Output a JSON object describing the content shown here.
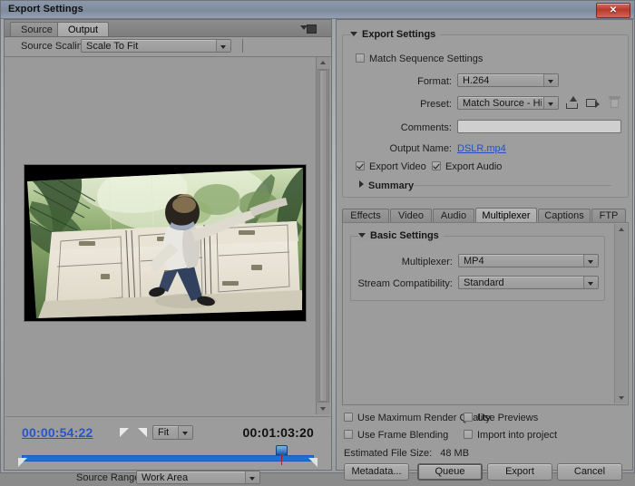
{
  "window": {
    "title": "Export Settings",
    "close_label": "✕"
  },
  "left_panel": {
    "tabs": [
      {
        "label": "Source",
        "active": false
      },
      {
        "label": "Output",
        "active": true
      }
    ],
    "panel_menu_icon": "panel-menu-icon",
    "source_scaling": {
      "label": "Source Scaling:",
      "value": "Scale To Fit"
    },
    "preview": {
      "alt": "video-preview-frame"
    },
    "transport": {
      "current_timecode": "00:00:54:22",
      "duration_timecode": "00:01:03:20",
      "mark_in_icon": "mark-in-icon",
      "mark_out_icon": "mark-out-icon",
      "zoom_level": "Fit",
      "playhead_percent": 88
    },
    "source_range": {
      "label": "Source Range:",
      "value": "Work Area"
    }
  },
  "right_panel": {
    "export_settings": {
      "title": "Export Settings",
      "expanded": true,
      "match_sequence_settings": {
        "label": "Match Sequence Settings",
        "checked": false
      },
      "format": {
        "label": "Format:",
        "value": "H.264"
      },
      "preset": {
        "label": "Preset:",
        "value": "Match Source - Hi..."
      },
      "preset_actions": [
        {
          "name": "save-preset-icon",
          "disabled": false
        },
        {
          "name": "import-preset-icon",
          "disabled": false
        },
        {
          "name": "delete-preset-icon",
          "disabled": true
        }
      ],
      "comments": {
        "label": "Comments:",
        "value": "",
        "placeholder": ""
      },
      "output_name": {
        "label": "Output Name:",
        "value": "DSLR.mp4"
      },
      "export_video": {
        "label": "Export Video",
        "checked": true
      },
      "export_audio": {
        "label": "Export Audio",
        "checked": true
      },
      "summary": {
        "label": "Summary",
        "expanded": false
      }
    },
    "format_tabs": [
      {
        "label": "Effects",
        "active": false
      },
      {
        "label": "Video",
        "active": false
      },
      {
        "label": "Audio",
        "active": false
      },
      {
        "label": "Multiplexer",
        "active": true
      },
      {
        "label": "Captions",
        "active": false
      },
      {
        "label": "FTP",
        "active": false
      }
    ],
    "basic_settings": {
      "title": "Basic Settings",
      "expanded": true,
      "multiplexer": {
        "label": "Multiplexer:",
        "value": "MP4"
      },
      "stream_compatibility": {
        "label": "Stream Compatibility:",
        "value": "Standard"
      }
    },
    "options": {
      "use_maximum_render_quality": {
        "label": "Use Maximum Render Quality",
        "checked": false
      },
      "use_previews": {
        "label": "Use Previews",
        "checked": false
      },
      "use_frame_blending": {
        "label": "Use Frame Blending",
        "checked": false
      },
      "import_into_project": {
        "label": "Import into project",
        "checked": false
      }
    },
    "estimated_file_size": {
      "label": "Estimated File Size:",
      "value": "48 MB"
    },
    "buttons": [
      {
        "label": "Metadata...",
        "default": false
      },
      {
        "label": "Queue",
        "default": true
      },
      {
        "label": "Export",
        "default": false
      },
      {
        "label": "Cancel",
        "default": false
      }
    ]
  },
  "colors": {
    "accent_blue": "#1f6fd0",
    "link_blue": "#2a4fb8",
    "titlebar": "#7e8b9e",
    "panel_bg": "#9c9c9c",
    "close_red": "#b63a2c"
  }
}
